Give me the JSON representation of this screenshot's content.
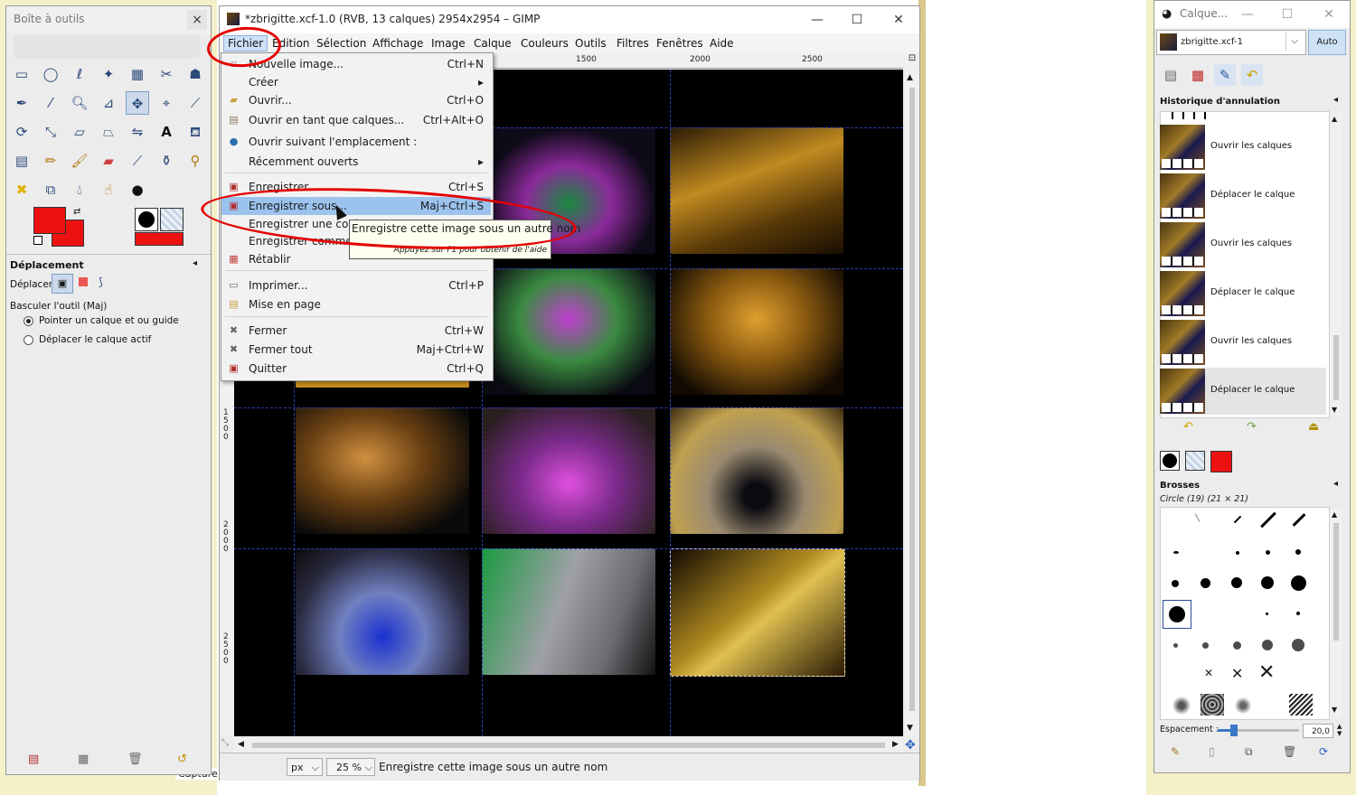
{
  "toolbox": {
    "title": "Boîte à outils",
    "tool_options_title": "Déplacement",
    "move_label": "Déplacer :",
    "toggle_label": "Basculer l'outil  (Maj)",
    "option1": "Pointer un calque et ou guide",
    "option2": "Déplacer le calque actif",
    "fg_color": "#ee1111",
    "bg_color": "#ee1111"
  },
  "gimp_window": {
    "title": "*zbrigitte.xcf-1.0 (RVB, 13 calques) 2954x2954 – GIMP",
    "menus": [
      "Fichier",
      "Édition",
      "Sélection",
      "Affichage",
      "Image",
      "Calque",
      "Couleurs",
      "Outils",
      "Filtres",
      "Fenêtres",
      "Aide"
    ],
    "ruler_top": [
      "1500",
      "2000",
      "2500"
    ],
    "ruler_left": [
      "1500",
      "2000",
      "2500"
    ],
    "status": {
      "unit": "px",
      "zoom": "25 %",
      "message": "Enregistre cette image sous un autre nom"
    }
  },
  "file_menu": {
    "items": [
      {
        "label": "Nouvelle image...",
        "shortcut": "Ctrl+N"
      },
      {
        "label": "Créer",
        "shortcut": ""
      },
      {
        "label": "Ouvrir...",
        "shortcut": "Ctrl+O"
      },
      {
        "label": "Ouvrir en tant que calques...",
        "shortcut": "Ctrl+Alt+O"
      },
      {
        "label": "Ouvrir suivant l'emplacement :",
        "shortcut": ""
      },
      {
        "label": "Récemment ouverts",
        "shortcut": ""
      },
      {
        "label": "Enregistrer",
        "shortcut": "Ctrl+S"
      },
      {
        "label": "Enregistrer sous...",
        "shortcut": "Maj+Ctrl+S"
      },
      {
        "label": "Enregistrer une copie",
        "shortcut": ""
      },
      {
        "label": "Enregistrer comme m",
        "shortcut": ""
      },
      {
        "label": "Rétablir",
        "shortcut": ""
      },
      {
        "label": "Imprimer...",
        "shortcut": "Ctrl+P"
      },
      {
        "label": "Mise en page",
        "shortcut": ""
      },
      {
        "label": "Fermer",
        "shortcut": "Ctrl+W"
      },
      {
        "label": "Fermer tout",
        "shortcut": "Maj+Ctrl+W"
      },
      {
        "label": "Quitter",
        "shortcut": "Ctrl+Q"
      }
    ]
  },
  "tooltip": {
    "main": "Enregistre cette image sous un autre nom",
    "hint": "Appuyez sur F1 pour obtenir de l'aide"
  },
  "dock": {
    "title": "Calque...",
    "image_select": "zbrigitte.xcf-1",
    "auto_button": "Auto",
    "history_title": "Historique d'annulation",
    "history": [
      "Ouvrir les calques",
      "Déplacer le calque",
      "Ouvrir les calques",
      "Déplacer le calque",
      "Ouvrir les calques",
      "Déplacer le calque"
    ],
    "brushes_title": "Brosses",
    "brush_name": "Circle (19) (21 × 21)",
    "spacing_label": "Espacement :",
    "spacing_value": "20,0",
    "spacing_fraction": 0.2,
    "colors": {
      "fg": "#000000",
      "bg": "#ee1111"
    }
  },
  "desktop": {
    "taskbar_hint": "Capture"
  }
}
